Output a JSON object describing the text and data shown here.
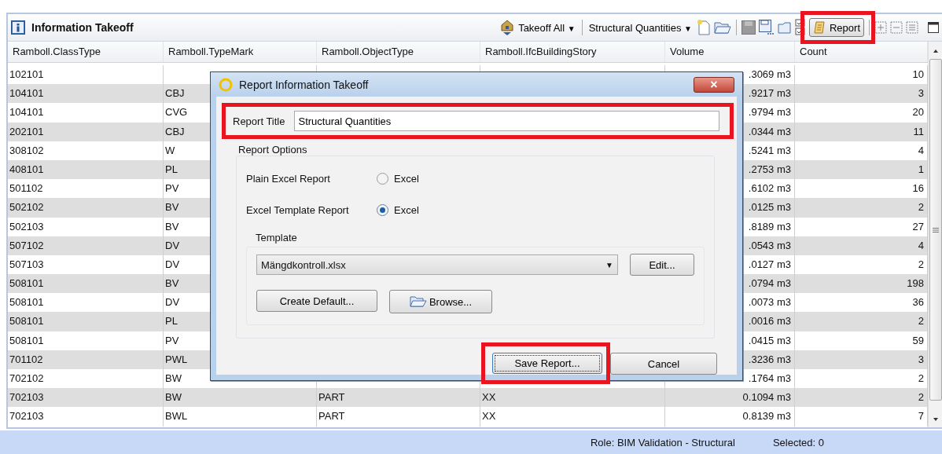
{
  "panel": {
    "title": "Information Takeoff"
  },
  "toolbar": {
    "takeoff_dropdown": "Takeoff All",
    "caret": "▼",
    "quantities_dropdown": "Structural Quantities",
    "report_button": "Report"
  },
  "table": {
    "columns": [
      "Ramboll.ClassType",
      "Ramboll.TypeMark",
      "Ramboll.ObjectType",
      "Ramboll.IfcBuildingStory",
      "Volume",
      "Count"
    ],
    "rows": [
      {
        "class_type": "102101",
        "type_mark": "",
        "object_type": "",
        "story": "",
        "volume": ".3069 m3",
        "count": "10"
      },
      {
        "class_type": "104101",
        "type_mark": "CBJ",
        "object_type": "",
        "story": "",
        "volume": ".9217 m3",
        "count": "3"
      },
      {
        "class_type": "104101",
        "type_mark": "CVG",
        "object_type": "",
        "story": "",
        "volume": ".9794 m3",
        "count": "20"
      },
      {
        "class_type": "202101",
        "type_mark": "CBJ",
        "object_type": "",
        "story": "",
        "volume": ".0344 m3",
        "count": "11"
      },
      {
        "class_type": "308102",
        "type_mark": "W",
        "object_type": "",
        "story": "",
        "volume": ".5241 m3",
        "count": "4"
      },
      {
        "class_type": "408101",
        "type_mark": "PL",
        "object_type": "",
        "story": "",
        "volume": ".2753 m3",
        "count": "1"
      },
      {
        "class_type": "501102",
        "type_mark": "PV",
        "object_type": "",
        "story": "",
        "volume": ".6102 m3",
        "count": "16"
      },
      {
        "class_type": "502102",
        "type_mark": "BV",
        "object_type": "",
        "story": "",
        "volume": ".0125 m3",
        "count": "2"
      },
      {
        "class_type": "502103",
        "type_mark": "BV",
        "object_type": "",
        "story": "",
        "volume": ".8189 m3",
        "count": "27"
      },
      {
        "class_type": "507102",
        "type_mark": "DV",
        "object_type": "",
        "story": "",
        "volume": ".0543 m3",
        "count": "4"
      },
      {
        "class_type": "507103",
        "type_mark": "DV",
        "object_type": "",
        "story": "",
        "volume": ".0127 m3",
        "count": "2"
      },
      {
        "class_type": "508101",
        "type_mark": "BV",
        "object_type": "",
        "story": "",
        "volume": ".0794 m3",
        "count": "198"
      },
      {
        "class_type": "508101",
        "type_mark": "DV",
        "object_type": "",
        "story": "",
        "volume": ".0073 m3",
        "count": "36"
      },
      {
        "class_type": "508101",
        "type_mark": "PL",
        "object_type": "",
        "story": "",
        "volume": ".0016 m3",
        "count": "2"
      },
      {
        "class_type": "508101",
        "type_mark": "PV",
        "object_type": "",
        "story": "",
        "volume": ".0415 m3",
        "count": "59"
      },
      {
        "class_type": "701102",
        "type_mark": "PWL",
        "object_type": "",
        "story": "",
        "volume": ".3236 m3",
        "count": "3"
      },
      {
        "class_type": "702102",
        "type_mark": "BW",
        "object_type": "",
        "story": "",
        "volume": ".1764 m3",
        "count": "2"
      },
      {
        "class_type": "702103",
        "type_mark": "BW",
        "object_type": "PART",
        "story": "XX",
        "volume": "0.1094 m3",
        "count": "2"
      },
      {
        "class_type": "702103",
        "type_mark": "BWL",
        "object_type": "PART",
        "story": "XX",
        "volume": "0.8139 m3",
        "count": "7"
      }
    ]
  },
  "dialog": {
    "title": "Report Information Takeoff",
    "close": "×",
    "report_title_label": "Report Title",
    "report_title_value": "Structural Quantities",
    "options_legend": "Report Options",
    "options": [
      {
        "label": "Plain Excel Report",
        "radio_label": "Excel",
        "selected": false
      },
      {
        "label": "Excel Template Report",
        "radio_label": "Excel",
        "selected": true
      }
    ],
    "template_legend": "Template",
    "template_value": "Mängdkontroll.xlsx",
    "dropdown_caret": "▼",
    "edit_button": "Edit...",
    "create_default_button": "Create Default...",
    "browse_button": "Browse...",
    "save_button": "Save Report...",
    "cancel_button": "Cancel"
  },
  "status_bar": {
    "role": "Role: BIM Validation - Structural",
    "selected": "Selected: 0"
  }
}
